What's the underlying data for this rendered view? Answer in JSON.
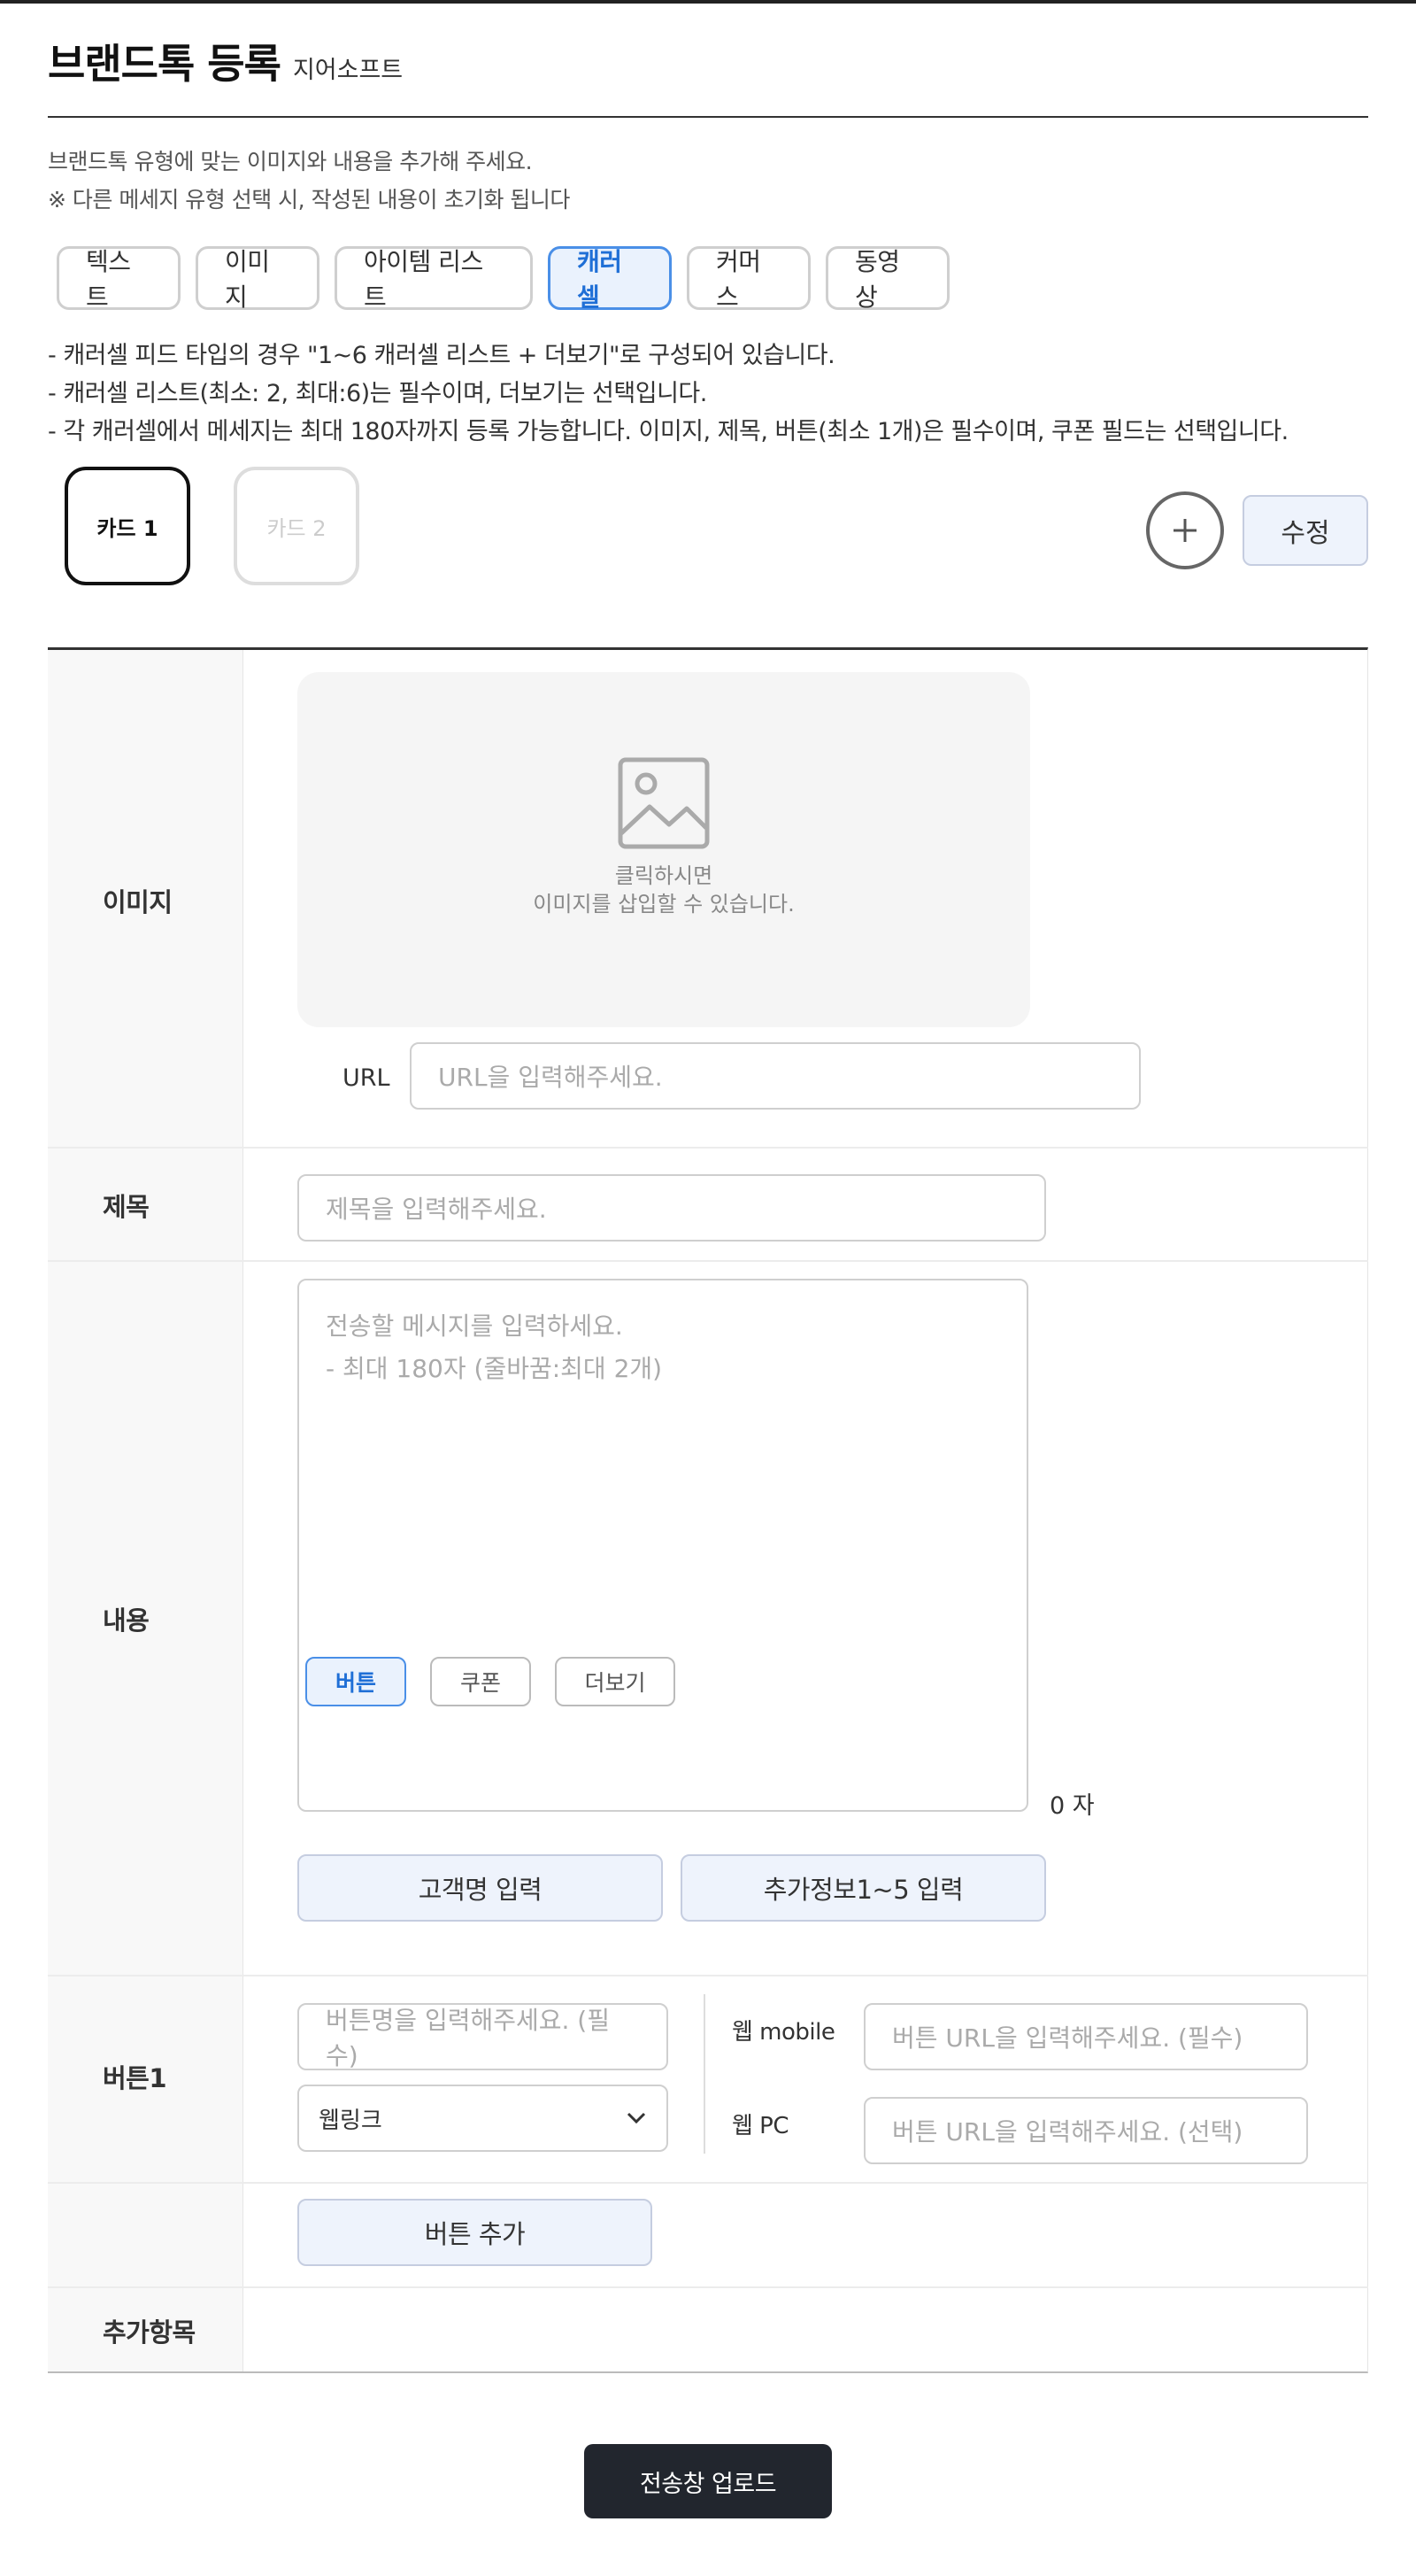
{
  "header": {
    "title": "브랜드톡 등록",
    "subtitle": "지어소프트"
  },
  "description": {
    "line1": "브랜드톡 유형에 맞는 이미지와 내용을 추가해 주세요.",
    "line2": "※ 다른 메세지 유형 선택 시, 작성된 내용이 초기화 됩니다"
  },
  "tabs": [
    {
      "label": "텍스트",
      "active": false
    },
    {
      "label": "이미지",
      "active": false
    },
    {
      "label": "아이템 리스트",
      "active": false
    },
    {
      "label": "캐러셀",
      "active": true
    },
    {
      "label": "커머스",
      "active": false
    },
    {
      "label": "동영상",
      "active": false
    }
  ],
  "notes": [
    "- 캐러셀 피드 타입의 경우 \"1~6 캐러셀 리스트 + 더보기\"로 구성되어 있습니다.",
    "- 캐러셀 리스트(최소: 2, 최대:6)는 필수이며, 더보기는 선택입니다.",
    "- 각 캐러셀에서 메세지는 최대 180자까지 등록 가능합니다. 이미지, 제목, 버튼(최소 1개)은 필수이며, 쿠폰 필드는 선택입니다."
  ],
  "cards": [
    {
      "label": "카드 1",
      "active": true
    },
    {
      "label": "카드 2",
      "active": false
    }
  ],
  "card_actions": {
    "add_icon": "plus-icon",
    "edit_label": "수정"
  },
  "form": {
    "image": {
      "label": "이미지",
      "icon": "image-placeholder-icon",
      "hint_line1": "클릭하시면",
      "hint_line2": "이미지를 삽입할 수 있습니다.",
      "url_label": "URL",
      "url_placeholder": "URL을 입력해주세요."
    },
    "title": {
      "label": "제목",
      "placeholder": "제목을 입력해주세요."
    },
    "content": {
      "label": "내용",
      "placeholder_line1": "전송할 메시지를 입력하세요.",
      "placeholder_line2": "- 최대 180자 (줄바꿈:최대 2개)",
      "counter": "0 자",
      "customer_name_button": "고객명 입력",
      "extra_info_button": "추가정보1~5 입력"
    },
    "button1": {
      "label": "버튼1",
      "name_placeholder": "버튼명을 입력해주세요. (필수)",
      "type_selected": "웹링크",
      "web_mobile_label": "웹 mobile",
      "web_mobile_placeholder": "버튼 URL을 입력해주세요. (필수)",
      "web_pc_label": "웹 PC",
      "web_pc_placeholder": "버튼 URL을 입력해주세요. (선택)"
    },
    "add_button_label": "버튼 추가",
    "extra_items": {
      "label": "추가항목",
      "chips": [
        {
          "label": "버튼",
          "active": true
        },
        {
          "label": "쿠폰",
          "active": false
        },
        {
          "label": "더보기",
          "active": false
        }
      ]
    }
  },
  "upload_button": "전송창 업로드",
  "colors": {
    "accent": "#4a8fe7",
    "accent_bg": "#eaf2fd",
    "secondary_button_bg": "#eef3fc",
    "primary_dark": "#22262e"
  }
}
